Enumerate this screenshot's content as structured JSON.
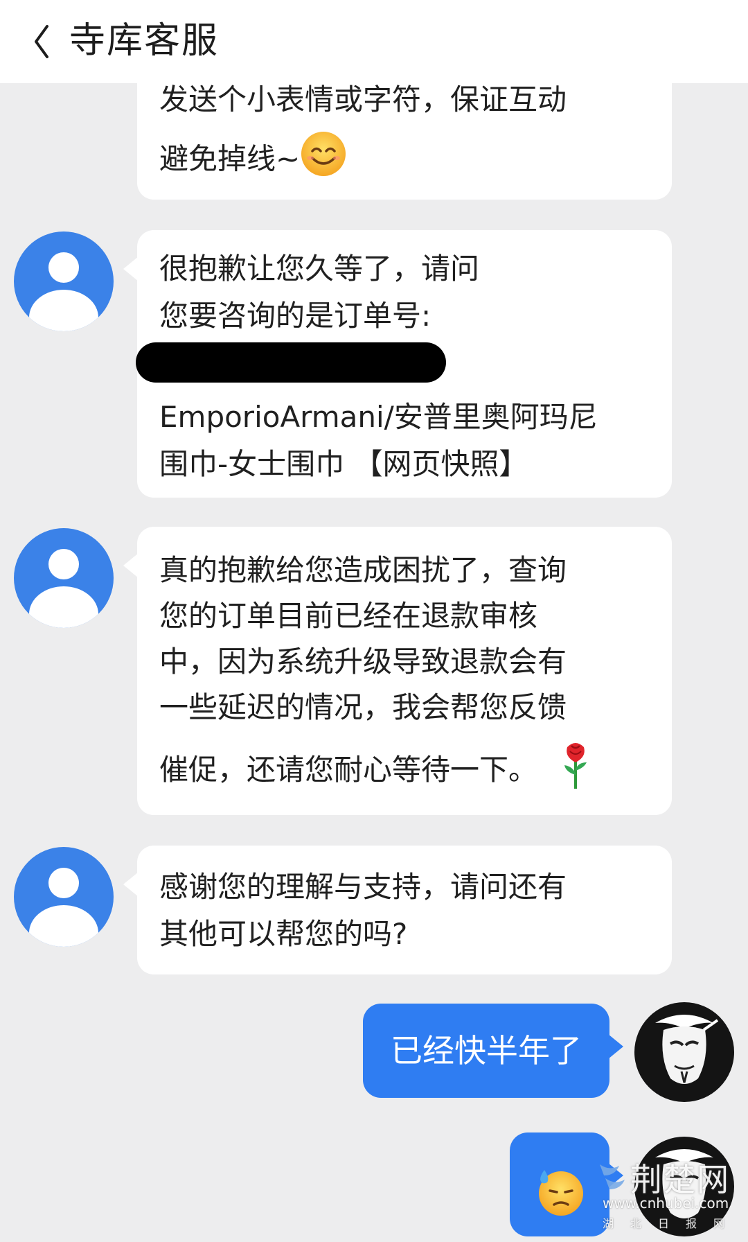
{
  "header": {
    "title": "寺库客服"
  },
  "messages": [
    {
      "sender": "agent",
      "partial": true,
      "lines": [
        "发送个小表情或字符，保证互动",
        "避免掉线~"
      ],
      "emoji": "smiling-face-emoji"
    },
    {
      "sender": "agent",
      "lines_before": [
        "很抱歉让您久等了，请问",
        "您要咨询的是订单号:"
      ],
      "redacted": true,
      "lines_after": [
        "EmporioArmani/安普里奥阿玛尼",
        "围巾-女士围巾 【网页快照】"
      ]
    },
    {
      "sender": "agent",
      "lines": [
        "真的抱歉给您造成困扰了，查询",
        "您的订单目前已经在退款审核",
        "中，因为系统升级导致退款会有",
        "一些延迟的情况，我会帮您反馈",
        "催促，还请您耐心等待一下。"
      ],
      "emoji": "rose-emoji"
    },
    {
      "sender": "agent",
      "lines": [
        "感谢您的理解与支持，请问还有",
        "其他可以帮您的吗?"
      ]
    },
    {
      "sender": "user",
      "text": "已经快半年了"
    },
    {
      "sender": "user",
      "emoji": "downcast-sweat-face-emoji"
    }
  ],
  "watermark": {
    "main": "荆楚网",
    "url": "www.cnhubei.com",
    "sub": "湖北日报网"
  },
  "colors": {
    "background": "#ededee",
    "agent_avatar": "#3b82e8",
    "user_bubble": "#2f7df2"
  }
}
